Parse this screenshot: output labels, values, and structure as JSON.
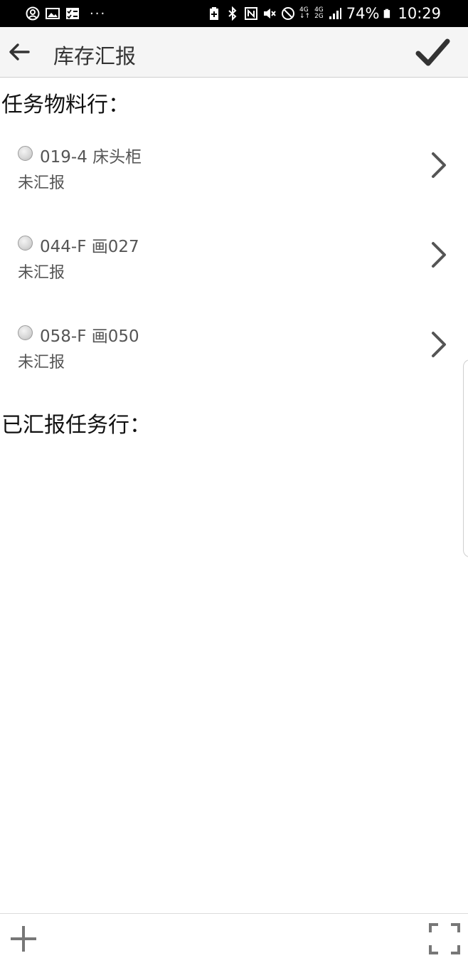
{
  "status_bar": {
    "left_icons": [
      "account-icon",
      "image-icon",
      "checklist-icon"
    ],
    "more": "···",
    "network_top": "4G",
    "network_bottom": "2G",
    "battery_percent": "74%",
    "time": "10:29"
  },
  "appbar": {
    "title": "库存汇报"
  },
  "tasks_section": {
    "title": "任务物料行：",
    "items": [
      {
        "name": "019-4 床头柜",
        "status": "未汇报"
      },
      {
        "name": "044-F 画027",
        "status": "未汇报"
      },
      {
        "name": "058-F 画050",
        "status": "未汇报"
      }
    ]
  },
  "reported_section": {
    "title": "已汇报任务行："
  },
  "colors": {
    "status_bar": "#000000",
    "appbar": "#f5f5f5",
    "icon": "#555555"
  }
}
